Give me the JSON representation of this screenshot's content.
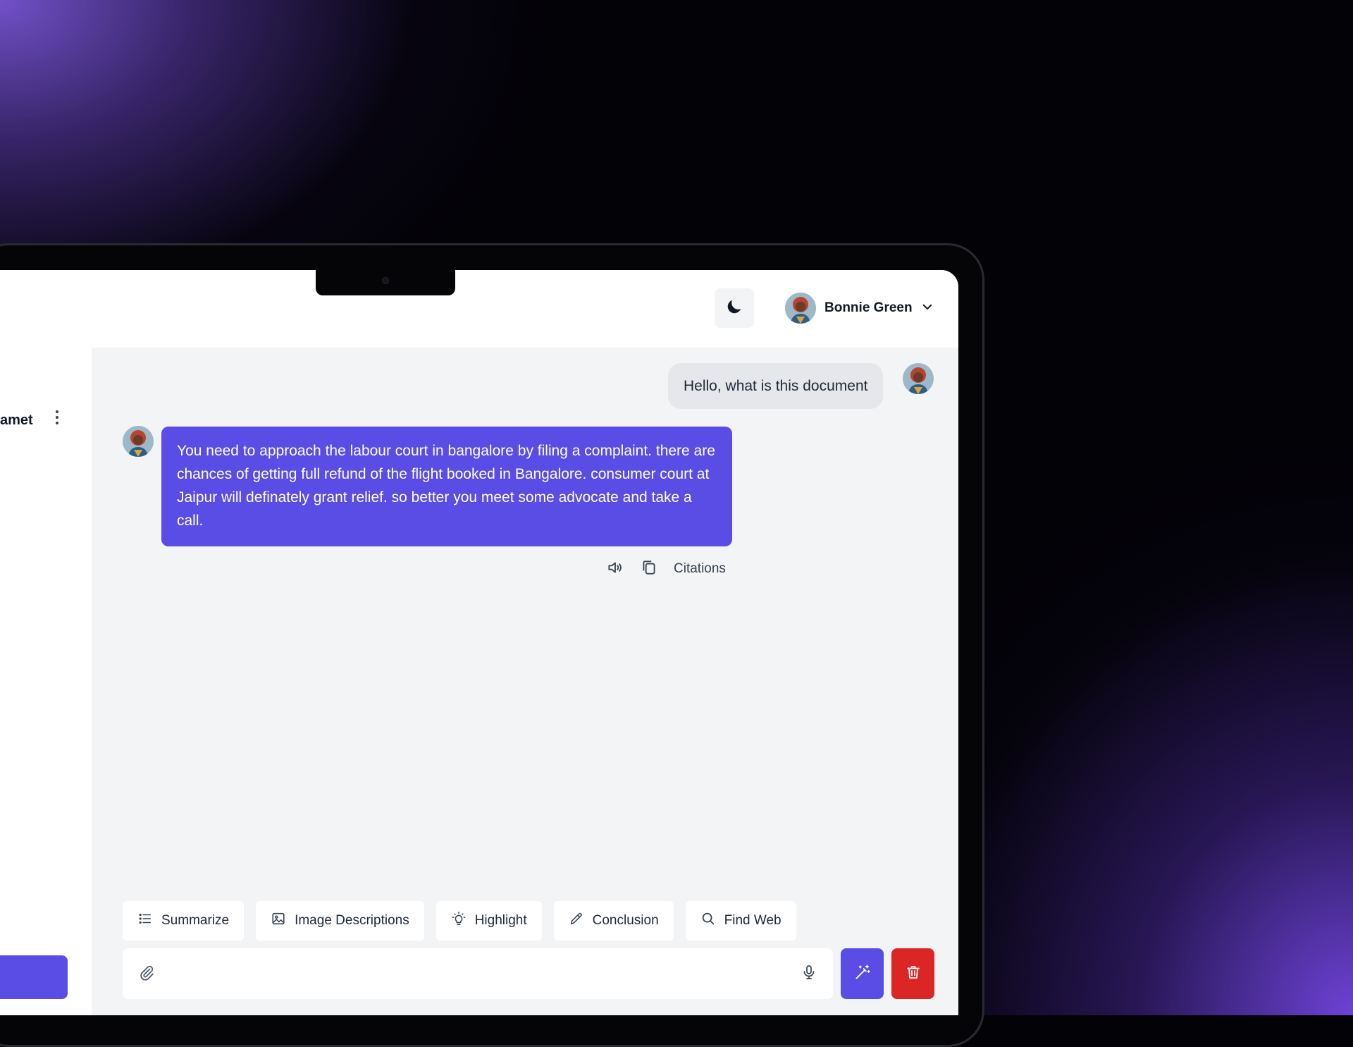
{
  "header": {
    "user_name": "Bonnie Green",
    "theme_toggle_icon": "moon-icon",
    "dropdown_icon": "chevron-down-icon"
  },
  "sidebar": {
    "item_label_partial": "amet",
    "menu_icon": "kebab-menu-icon"
  },
  "chat": {
    "messages": [
      {
        "role": "user",
        "text": "Hello, what is this document"
      },
      {
        "role": "assistant",
        "text": "You need to approach the labour court in bangalore by filing a complaint. there are chances of getting full refund of the flight booked in Bangalore. consumer court at Jaipur will definately grant relief. so better you meet some advocate and take a call."
      }
    ],
    "actions": {
      "speak_icon": "speaker-icon",
      "copy_icon": "copy-icon",
      "citations_label": "Citations"
    }
  },
  "suggestions": [
    {
      "label": "Summarize",
      "icon": "list-icon"
    },
    {
      "label": "Image Descriptions",
      "icon": "image-icon"
    },
    {
      "label": "Highlight",
      "icon": "lightbulb-icon"
    },
    {
      "label": "Conclusion",
      "icon": "pencil-icon"
    },
    {
      "label": "Find Web",
      "icon": "search-icon"
    }
  ],
  "composer": {
    "placeholder": "",
    "attach_icon": "paperclip-icon",
    "mic_icon": "microphone-icon",
    "magic_icon": "magic-wand-icon",
    "delete_icon": "trash-icon"
  },
  "colors": {
    "accent": "#5a4de6",
    "danger": "#dc2626",
    "surface": "#f3f4f6",
    "user_bubble": "#e5e7eb"
  }
}
